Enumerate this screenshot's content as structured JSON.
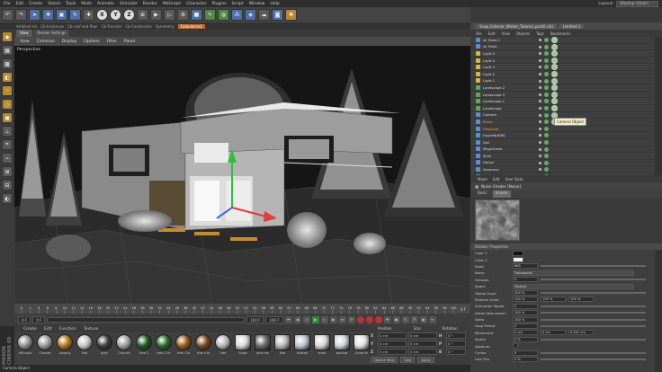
{
  "menubar": {
    "items": [
      "File",
      "Edit",
      "Create",
      "Select",
      "Tools",
      "Mesh",
      "Animate",
      "Simulate",
      "Render",
      "MoGraph",
      "Character",
      "Plugins",
      "Script",
      "Window",
      "Help"
    ],
    "layout_label": "Layout:",
    "layout_value": "Startup (User)"
  },
  "toolbar": {
    "axis_buttons": [
      "X",
      "Y",
      "Z"
    ]
  },
  "subtabs": [
    "Ambient kit",
    "Cb-Instances",
    "Cb-roof and floor",
    "Cb-Transfer",
    "Cb-Constraints",
    "Symmetry",
    "Turbulence1"
  ],
  "viewport": {
    "tabs": [
      "View",
      "Render Settings"
    ],
    "menu": [
      "View",
      "Cameras",
      "Display",
      "Options",
      "Filter",
      "Panel"
    ],
    "label": "Perspective"
  },
  "timeline": {
    "ticks": [
      "0",
      "2",
      "4",
      "6",
      "8",
      "10",
      "12",
      "14",
      "16",
      "18",
      "20",
      "22",
      "24",
      "26",
      "28",
      "30",
      "32",
      "34",
      "36",
      "38",
      "40",
      "42",
      "44",
      "46",
      "48",
      "50",
      "52",
      "54",
      "56",
      "58",
      "60",
      "62",
      "64",
      "66",
      "68",
      "70",
      "72",
      "74",
      "76",
      "78",
      "80",
      "82",
      "84",
      "86",
      "88",
      "90",
      "92",
      "94",
      "96",
      "98",
      "100"
    ],
    "frame_end_marker": "0 F"
  },
  "playbar": {
    "start": "0 F",
    "start2": "0 F",
    "end": "100 F",
    "end2": "100 F"
  },
  "material_manager": {
    "menu": [
      "Create",
      "Edit",
      "Function",
      "Texture"
    ],
    "materials": [
      {
        "name": "diff.color",
        "color": "#8f8f8f"
      },
      {
        "name": "Concret",
        "color": "#9a9a9a"
      },
      {
        "name": "wood g",
        "color": "#b0781e"
      },
      {
        "name": "Mat",
        "color": "#c5c5c5"
      },
      {
        "name": "grey",
        "color": "#3c3c3c"
      },
      {
        "name": "Concret",
        "color": "#a0a0a0"
      },
      {
        "name": "tree 1",
        "color": "#1f5a22"
      },
      {
        "name": "tree 2 lin",
        "color": "#2a6a2c"
      },
      {
        "name": "tree 3 lo",
        "color": "#9a5a18"
      },
      {
        "name": "tree 4 lo",
        "color": "#7a4a20"
      },
      {
        "name": "Mat",
        "color": "#b3b3b3"
      },
      {
        "name": "Snow",
        "color": "#dadada"
      },
      {
        "name": "pine me",
        "color": "#6a6a6a"
      },
      {
        "name": "Mat",
        "color": "#b8b8b8"
      },
      {
        "name": "frosted",
        "color": "#c0c4cc"
      },
      {
        "name": "snow",
        "color": "#d8d8d8"
      },
      {
        "name": "window",
        "color": "#cfd3db"
      },
      {
        "name": "Snow dt",
        "color": "#e0e0e0"
      },
      {
        "name": "snow de",
        "color": "#dcdcdc"
      }
    ],
    "brand": "MAXON CINEMA 4D"
  },
  "coordinates": {
    "headers": [
      "Position",
      "Size",
      "Rotation"
    ],
    "rows": [
      {
        "axis": "X",
        "pos": "0 cm",
        "size": "0 cm",
        "rot_axis": "H",
        "rot": "0 °"
      },
      {
        "axis": "Y",
        "pos": "0 cm",
        "size": "0 cm",
        "rot_axis": "P",
        "rot": "0 °"
      },
      {
        "axis": "Z",
        "pos": "0 cm",
        "size": "0 cm",
        "rot_axis": "B",
        "rot": "0 °"
      }
    ],
    "mode": "Object (Rel)",
    "size_mode": "Size",
    "apply": "Apply"
  },
  "status": "Camera Object",
  "object_manager": {
    "tab": "Snap_Exterior_Winter_Tutorial_partill.c4d",
    "tab2": "Untitled 3",
    "menu": [
      "File",
      "Edit",
      "View",
      "Objects",
      "Tags",
      "Bookmarks"
    ],
    "objects": [
      {
        "name": "sh Fixed.1",
        "selected": false
      },
      {
        "name": "sh Fixed",
        "selected": false
      },
      {
        "name": "Light.5",
        "selected": false
      },
      {
        "name": "Light.4",
        "selected": false
      },
      {
        "name": "Light.3",
        "selected": false
      },
      {
        "name": "Light.2",
        "selected": false
      },
      {
        "name": "Light.1",
        "selected": false
      },
      {
        "name": "Landscape.2",
        "selected": false
      },
      {
        "name": "Landscape.3",
        "selected": false
      },
      {
        "name": "Landscape.1",
        "selected": false
      },
      {
        "name": "Landscape",
        "selected": false
      },
      {
        "name": "Camera",
        "selected": false
      },
      {
        "name": "Plane",
        "selected": true
      },
      {
        "name": "Displacer",
        "selected": true
      },
      {
        "name": "HyperNURBS",
        "selected": false
      },
      {
        "name": "Null",
        "selected": false
      },
      {
        "name": "MagicSnow",
        "selected": false
      },
      {
        "name": "Shell",
        "selected": false
      },
      {
        "name": "House",
        "selected": false
      },
      {
        "name": "Greenery",
        "selected": false
      },
      {
        "name": "Yard",
        "selected": false
      }
    ],
    "tooltip": "Camera Object"
  },
  "attribute_manager": {
    "menu": [
      "Mode",
      "Edit",
      "User Data"
    ],
    "title": "Noise Shader [Noise]",
    "tabs": [
      "Basic",
      "Shader"
    ],
    "section": "Shader Properties",
    "params": [
      {
        "label": "Color 1",
        "value": "",
        "type": "swatch",
        "color": "#111111"
      },
      {
        "label": "Color 2",
        "value": "",
        "type": "swatch",
        "color": "#f0f0f0"
      },
      {
        "label": "Seed",
        "value": "665",
        "type": "num"
      },
      {
        "label": "Noise",
        "value": "Turbulence",
        "type": "dd"
      },
      {
        "label": "Octaves",
        "value": "5",
        "type": "num"
      },
      {
        "label": "Space",
        "value": "Texture",
        "type": "dd"
      },
      {
        "label": "Global Scale",
        "value": "500 %",
        "type": "num"
      },
      {
        "label": "Relative Scale",
        "value": "100 %",
        "type": "num3",
        "v2": "100 %",
        "v3": "100 %"
      },
      {
        "label": "Animation Speed",
        "value": "0",
        "type": "num"
      },
      {
        "label": "Detail Attenuation",
        "value": "100 %",
        "type": "num"
      },
      {
        "label": "Delta",
        "value": "100 %",
        "type": "num"
      },
      {
        "label": "Loop Period",
        "value": "0",
        "type": "num"
      },
      {
        "label": "Movement",
        "value": "0 cm",
        "type": "num3",
        "v2": "0 cm",
        "v3": "0.001 cm"
      },
      {
        "label": "Speed",
        "value": "0 %",
        "type": "num"
      },
      {
        "label": "Absolute",
        "value": "",
        "type": "check"
      },
      {
        "label": "Cycles",
        "value": "0",
        "type": "num"
      },
      {
        "label": "Low Clip",
        "value": "0 %",
        "type": "num"
      }
    ]
  }
}
